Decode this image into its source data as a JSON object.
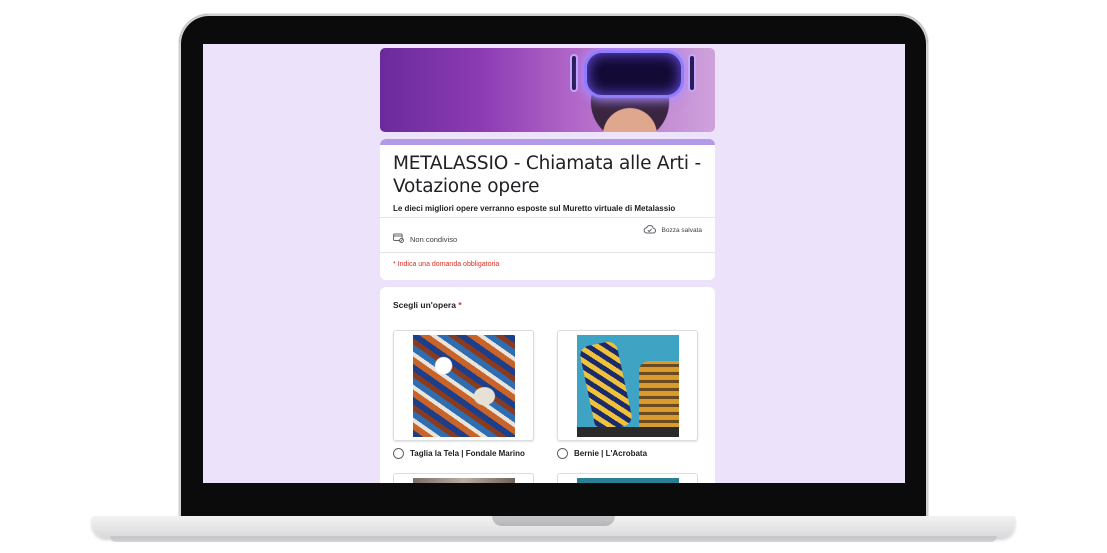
{
  "form": {
    "title_line1": "METALASSIO - Chiamata alle Arti -",
    "title_line2": "Votazione opere",
    "description": "Le dieci migliori opere verranno esposte sul Muretto virtuale di Metalassio",
    "share_status": "Non condiviso",
    "draft_status": "Bozza salvata",
    "required_note": "* Indica una domanda obbligatoria"
  },
  "question": {
    "label": "Scegli un'opera",
    "required_mark": "*",
    "options": [
      {
        "label": "Taglia la Tela | Fondale Marino"
      },
      {
        "label": "Bernie | L'Acrobata"
      }
    ]
  },
  "colors": {
    "screen_background": "#ece3fb",
    "accent": "#b39ae8",
    "required": "#d93025"
  },
  "icons": [
    "share-status-icon",
    "cloud-saved-icon",
    "radio-icon"
  ]
}
